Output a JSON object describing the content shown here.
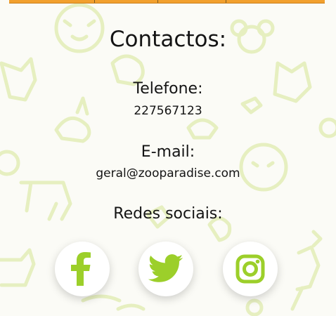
{
  "contacts": {
    "title": "Contactos:",
    "phone_label": "Telefone:",
    "phone_value": "227567123",
    "email_label": "E-mail:",
    "email_value": "geral@zooparadise.com",
    "social_label": "Redes sociais:"
  },
  "social_links": [
    {
      "icon": "facebook-icon"
    },
    {
      "icon": "twitter-icon"
    },
    {
      "icon": "instagram-icon"
    }
  ],
  "colors": {
    "accent": "#9ccf2a",
    "pattern": "#e6efc0",
    "background": "#fbfbf6",
    "top_bar": "#f2a02e"
  }
}
